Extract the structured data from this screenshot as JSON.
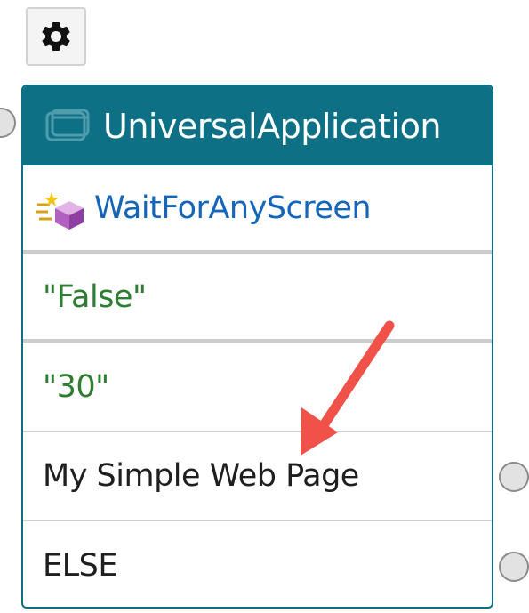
{
  "toolbar": {
    "settings_icon": "gear-icon"
  },
  "node": {
    "title": "UniversalApplication",
    "header_icon": "application-window-icon",
    "header_color": "#0e7085",
    "action": {
      "label": "WaitForAnyScreen",
      "icon": "wait-for-screen-icon"
    },
    "params": [
      {
        "value": "\"False\""
      },
      {
        "value": "\"30\""
      }
    ],
    "exits": [
      {
        "label": "My Simple Web Page"
      },
      {
        "label": "ELSE"
      }
    ]
  },
  "annotation": {
    "arrow_color": "#f0524a",
    "target": "My Simple Web Page"
  }
}
